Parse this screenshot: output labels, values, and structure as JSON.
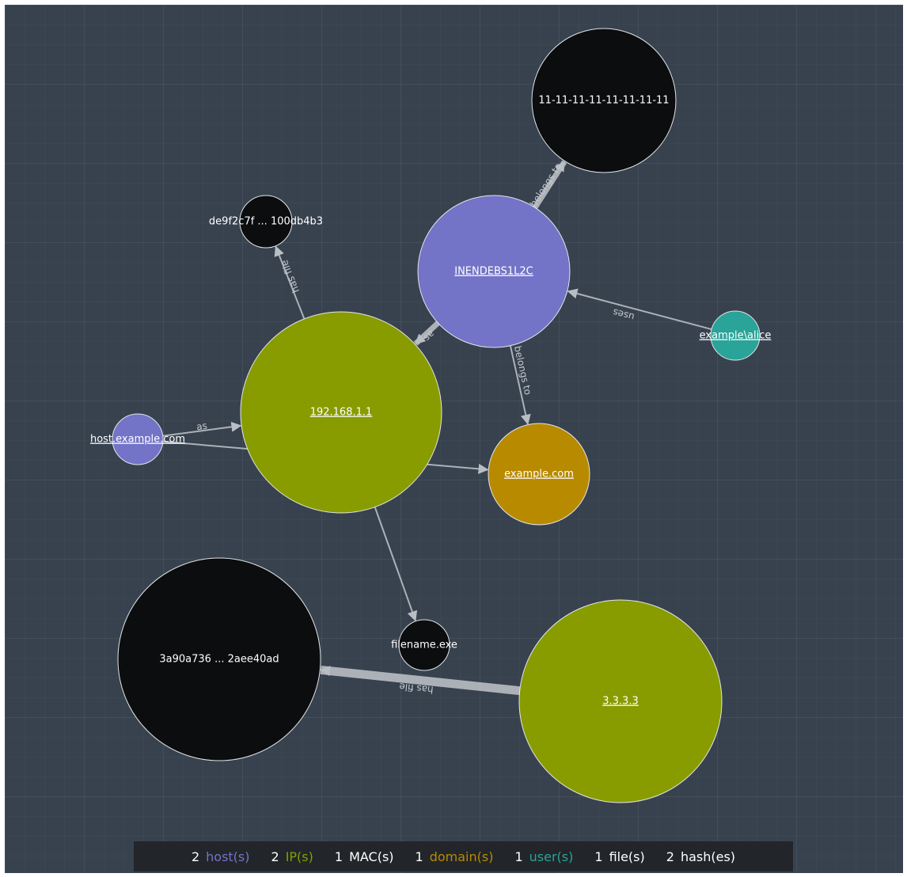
{
  "colors": {
    "host": "#7373c8",
    "ip": "#889c00",
    "mac": "#0b0d0f",
    "domain": "#b88a00",
    "user": "#2aa398",
    "file": "#0b0d0f",
    "hash": "#0b0d0f",
    "edge": "#b9bec4",
    "background": "#37424e"
  },
  "nodes": [
    {
      "id": "mac1",
      "type": "mac",
      "label": "11-11-11-11-11-11-11-11",
      "link": false
    },
    {
      "id": "host1",
      "type": "host",
      "label": "INENDEBS1L2C",
      "link": true
    },
    {
      "id": "hash1",
      "type": "hash",
      "label": "de9f2c7f ... 100db4b3",
      "link": false
    },
    {
      "id": "ip1",
      "type": "ip",
      "label": "192.168.1.1",
      "link": true
    },
    {
      "id": "user1",
      "type": "user",
      "label": "example\\alice",
      "link": true
    },
    {
      "id": "host2",
      "type": "host",
      "label": "host.example.com",
      "link": true
    },
    {
      "id": "domain1",
      "type": "domain",
      "label": "example.com",
      "link": true
    },
    {
      "id": "hash2",
      "type": "hash",
      "label": "3a90a736 ... 2aee40ad",
      "link": false
    },
    {
      "id": "file1",
      "type": "file",
      "label": "filename.exe",
      "link": false
    },
    {
      "id": "ip2",
      "type": "ip",
      "label": "3.3.3.3",
      "link": true
    }
  ],
  "edges": [
    {
      "from": "host1",
      "to": "mac1",
      "label": "belongs to",
      "weight": "thick"
    },
    {
      "from": "host1",
      "to": "ip1",
      "label": "as",
      "weight": "thick"
    },
    {
      "from": "host1",
      "to": "domain1",
      "label": "belongs to",
      "weight": "normal"
    },
    {
      "from": "user1",
      "to": "host1",
      "label": "uses",
      "weight": "normal"
    },
    {
      "from": "ip1",
      "to": "hash1",
      "label": "has file",
      "weight": "normal"
    },
    {
      "from": "host2",
      "to": "ip1",
      "label": "as",
      "weight": "normal"
    },
    {
      "from": "host2",
      "to": "domain1",
      "label": "",
      "weight": "normal"
    },
    {
      "from": "ip1",
      "to": "file1",
      "label": "",
      "weight": "normal"
    },
    {
      "from": "ip2",
      "to": "hash2",
      "label": "has file",
      "weight": "heavy"
    }
  ],
  "legend": [
    {
      "count": "2",
      "label": "host(s)",
      "type": "host"
    },
    {
      "count": "2",
      "label": "IP(s)",
      "type": "ip"
    },
    {
      "count": "1",
      "label": "MAC(s)",
      "type": "mac"
    },
    {
      "count": "1",
      "label": "domain(s)",
      "type": "domain"
    },
    {
      "count": "1",
      "label": "user(s)",
      "type": "user"
    },
    {
      "count": "1",
      "label": "file(s)",
      "type": "file"
    },
    {
      "count": "2",
      "label": "hash(es)",
      "type": "hash"
    }
  ]
}
